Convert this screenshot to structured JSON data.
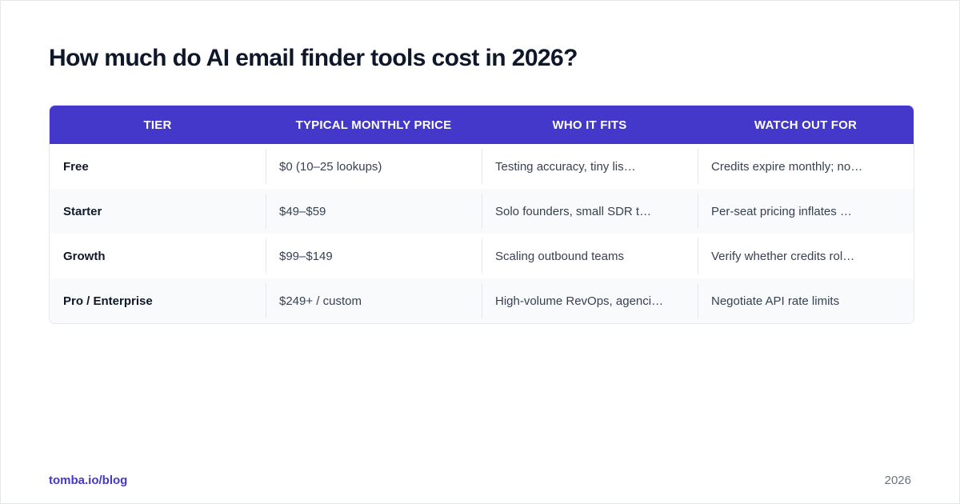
{
  "title": "How much do AI email finder tools cost in 2026?",
  "colors": {
    "header_bg": "#4338ca",
    "header_text": "#ffffff",
    "alt_row_bg": "#f8fafc",
    "brand_link": "#4338ca"
  },
  "table": {
    "headers": [
      "TIER",
      "TYPICAL MONTHLY PRICE",
      "WHO IT FITS",
      "WATCH OUT FOR"
    ],
    "rows": [
      [
        "Free",
        "$0 (10–25 lookups)",
        "Testing accuracy, tiny lis…",
        "Credits expire monthly; no…"
      ],
      [
        "Starter",
        "$49–$59",
        "Solo founders, small SDR t…",
        "Per-seat pricing inflates …"
      ],
      [
        "Growth",
        "$99–$149",
        "Scaling outbound teams",
        "Verify whether credits rol…"
      ],
      [
        "Pro / Enterprise",
        "$249+ / custom",
        "High-volume RevOps, agenci…",
        "Negotiate API rate limits"
      ]
    ]
  },
  "footer": {
    "source": "tomba.io/blog",
    "year": "2026"
  }
}
